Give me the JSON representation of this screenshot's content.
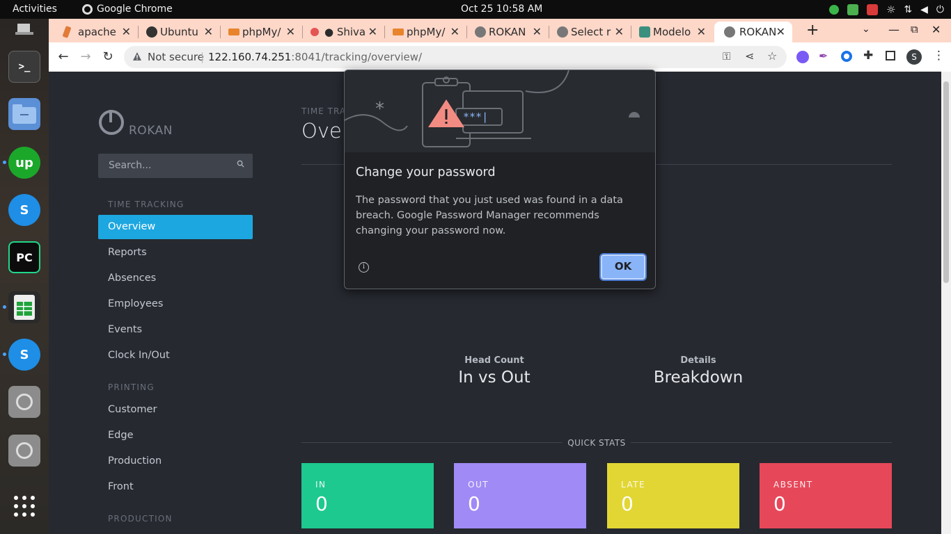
{
  "system_bar": {
    "activities": "Activities",
    "app_name": "Google Chrome",
    "clock": "Oct 25  10:58 AM"
  },
  "tabs": [
    {
      "title": "apache"
    },
    {
      "title": "Ubuntu"
    },
    {
      "title": "phpMy/"
    },
    {
      "title": "● Shiva"
    },
    {
      "title": "phpMy/"
    },
    {
      "title": "ROKAN"
    },
    {
      "title": "Select r"
    },
    {
      "title": "Modelo"
    },
    {
      "title": "ROKAN"
    }
  ],
  "new_tab_label": "+",
  "omnibox": {
    "security": "Not secure",
    "separator": "|",
    "host": "122.160.74.251",
    "path": ":8041/tracking/overview/"
  },
  "sidebar": {
    "brand": "ROKAN",
    "search_placeholder": "Search...",
    "sections": [
      {
        "title": "TIME TRACKING",
        "items": [
          "Overview",
          "Reports",
          "Absences",
          "Employees",
          "Events",
          "Clock In/Out"
        ]
      },
      {
        "title": "PRINTING",
        "items": [
          "Customer",
          "Edge",
          "Production",
          "Front"
        ]
      },
      {
        "title": "PRODUCTION",
        "items": []
      }
    ]
  },
  "main": {
    "crumb": "TIME TRA",
    "title": "Over",
    "head_count": {
      "small": "Head Count",
      "big": "In vs Out"
    },
    "details": {
      "small": "Details",
      "big": "Breakdown"
    },
    "quick_stats_label": "QUICK STATS",
    "cards": [
      {
        "label": "IN",
        "value": "0",
        "color": "#1dc98f"
      },
      {
        "label": "OUT",
        "value": "0",
        "color": "#a08af5"
      },
      {
        "label": "LATE",
        "value": "0",
        "color": "#e2d634"
      },
      {
        "label": "ABSENT",
        "value": "0",
        "color": "#e6485a"
      }
    ]
  },
  "dialog": {
    "title": "Change your password",
    "body": "The password that you just used was found in a data breach. Google Password Manager recommends changing your password now.",
    "ok": "OK",
    "hero_text": "***|"
  },
  "colors": {
    "tabstrip": "#fdd7c8",
    "accent": "#1da7e0",
    "dialog_button": "#8ab4f8"
  }
}
